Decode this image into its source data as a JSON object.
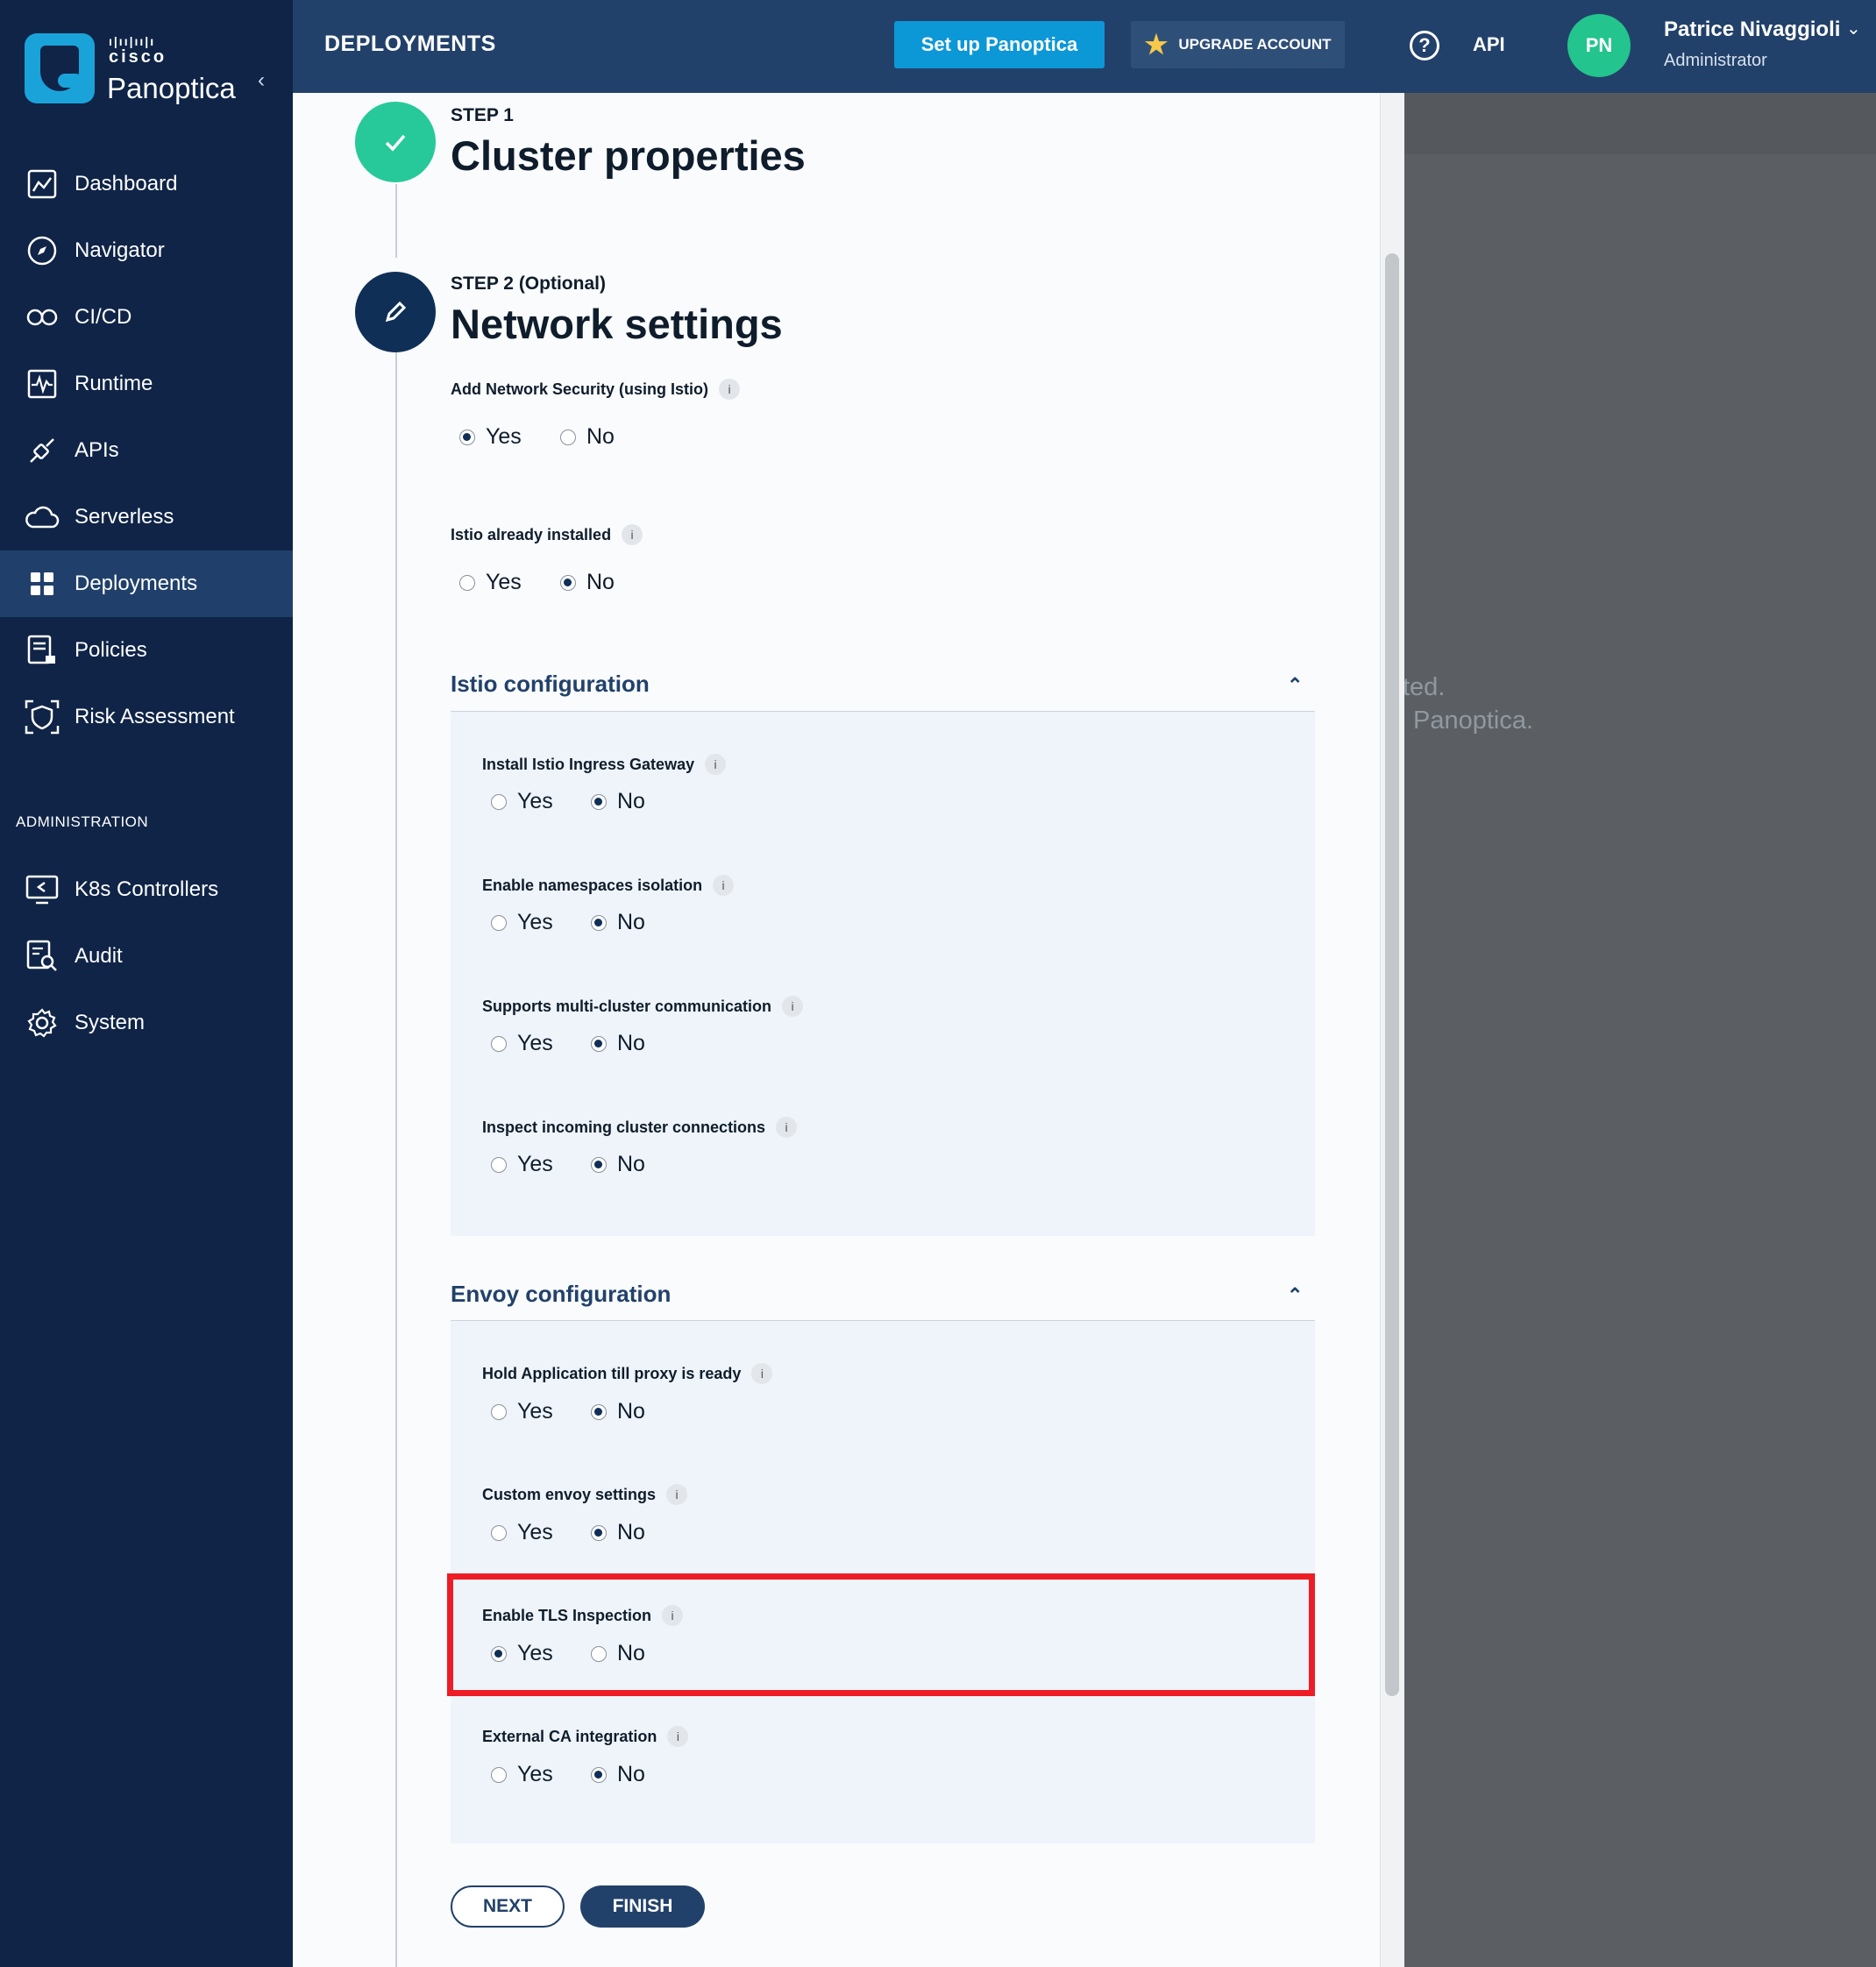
{
  "brand": {
    "cisco": "cisco",
    "product": "Panoptica",
    "collapse_icon": "chevron-left-icon"
  },
  "nav": [
    {
      "label": "Dashboard",
      "icon": "dashboard-icon"
    },
    {
      "label": "Navigator",
      "icon": "compass-icon"
    },
    {
      "label": "CI/CD",
      "icon": "cicd-icon"
    },
    {
      "label": "Runtime",
      "icon": "runtime-icon"
    },
    {
      "label": "APIs",
      "icon": "api-plug-icon"
    },
    {
      "label": "Serverless",
      "icon": "cloud-icon"
    },
    {
      "label": "Deployments",
      "icon": "grid-icon",
      "active": true
    },
    {
      "label": "Policies",
      "icon": "policy-lock-icon"
    },
    {
      "label": "Risk Assessment",
      "icon": "shield-scan-icon"
    }
  ],
  "admin": {
    "header": "ADMINISTRATION",
    "items": [
      {
        "label": "K8s Controllers",
        "icon": "monitor-icon"
      },
      {
        "label": "Audit",
        "icon": "audit-search-icon"
      },
      {
        "label": "System",
        "icon": "gear-icon"
      }
    ]
  },
  "topbar": {
    "title": "DEPLOYMENTS",
    "setup_label": "Set up Panoptica",
    "upgrade_label": "UPGRADE ACCOUNT",
    "api_label": "API",
    "avatar_initials": "PN",
    "user_name": "Patrice Nivaggioli",
    "user_role": "Administrator"
  },
  "background": {
    "line1": "ted.",
    "line2": "Panoptica."
  },
  "steps": {
    "step1": {
      "label": "STEP 1",
      "title": "Cluster properties",
      "status": "complete"
    },
    "step2": {
      "label": "STEP 2 (Optional)",
      "title": "Network settings",
      "status": "editing"
    }
  },
  "network": {
    "add_security": {
      "label": "Add Network Security (using Istio)",
      "yes": "Yes",
      "no": "No",
      "value": "Yes"
    },
    "istio_installed": {
      "label": "Istio already installed",
      "yes": "Yes",
      "no": "No",
      "value": "No"
    }
  },
  "istio": {
    "title": "Istio configuration",
    "fields": [
      {
        "label": "Install Istio Ingress Gateway",
        "yes": "Yes",
        "no": "No",
        "value": "No"
      },
      {
        "label": "Enable namespaces isolation",
        "yes": "Yes",
        "no": "No",
        "value": "No"
      },
      {
        "label": "Supports multi-cluster communication",
        "yes": "Yes",
        "no": "No",
        "value": "No"
      },
      {
        "label": "Inspect incoming cluster connections",
        "yes": "Yes",
        "no": "No",
        "value": "No"
      }
    ]
  },
  "envoy": {
    "title": "Envoy configuration",
    "fields": [
      {
        "label": "Hold Application till proxy is ready",
        "yes": "Yes",
        "no": "No",
        "value": "No"
      },
      {
        "label": "Custom envoy settings",
        "yes": "Yes",
        "no": "No",
        "value": "No"
      },
      {
        "label": "Enable TLS Inspection",
        "yes": "Yes",
        "no": "No",
        "value": "Yes",
        "highlighted": true
      },
      {
        "label": "External CA integration",
        "yes": "Yes",
        "no": "No",
        "value": "No"
      }
    ]
  },
  "actions": {
    "next": "NEXT",
    "finish": "FINISH"
  },
  "colors": {
    "sidebar": "#0f2447",
    "topbar": "#22416a",
    "accent": "#0c97d7",
    "success": "#27c99a",
    "highlight": "#ee1c25"
  }
}
